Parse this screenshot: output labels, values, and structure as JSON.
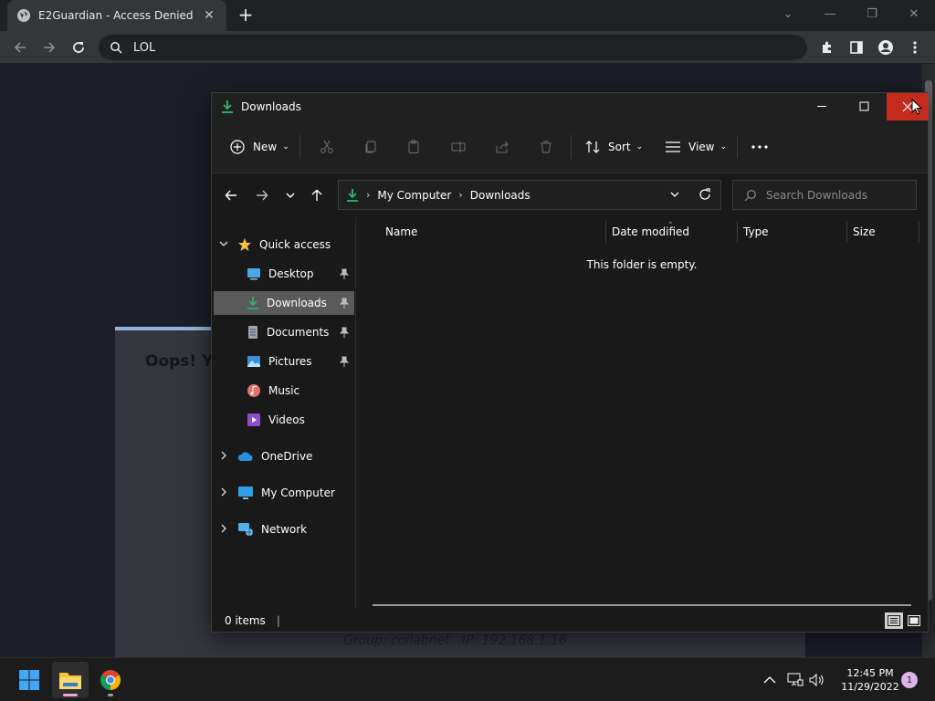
{
  "browser": {
    "tab_title": "E2Guardian - Access Denied",
    "omnibox_text": "LOL"
  },
  "page": {
    "oops_text": "Oops! Yo",
    "group_line": "Group: collabnet   IP: 192.168.1.16"
  },
  "explorer": {
    "title": "Downloads",
    "commands": {
      "new_label": "New",
      "sort_label": "Sort",
      "view_label": "View"
    },
    "breadcrumb": [
      "My Computer",
      "Downloads"
    ],
    "search_placeholder": "Search Downloads",
    "sidebar": {
      "quick_access": "Quick access",
      "items": [
        {
          "label": "Desktop",
          "pinned": true
        },
        {
          "label": "Downloads",
          "pinned": true,
          "selected": true
        },
        {
          "label": "Documents",
          "pinned": true
        },
        {
          "label": "Pictures",
          "pinned": true
        },
        {
          "label": "Music",
          "pinned": false
        },
        {
          "label": "Videos",
          "pinned": false
        }
      ],
      "onedrive": "OneDrive",
      "my_computer": "My Computer",
      "network": "Network"
    },
    "columns": [
      "Name",
      "Date modified",
      "Type",
      "Size"
    ],
    "empty_message": "This folder is empty.",
    "status": "0 items"
  },
  "taskbar": {
    "time": "12:45 PM",
    "date": "11/29/2022",
    "notification_count": "1"
  },
  "colors": {
    "accent_green": "#2bb673",
    "close_red": "#c42b1c",
    "folder_yellow": "#f4c23d"
  }
}
